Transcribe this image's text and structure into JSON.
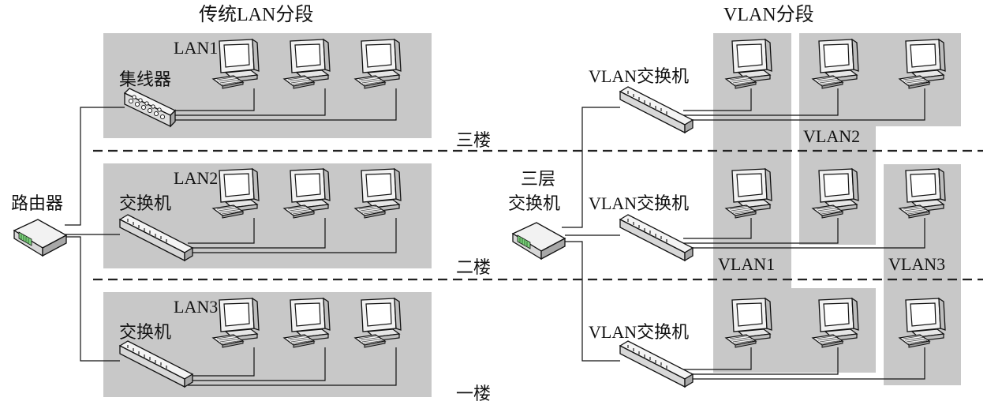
{
  "left": {
    "title": "传统LAN分段",
    "router_label": "路由器",
    "lans": [
      {
        "name": "LAN1",
        "device": "集线器"
      },
      {
        "name": "LAN2",
        "device": "交换机"
      },
      {
        "name": "LAN3",
        "device": "交换机"
      }
    ]
  },
  "right": {
    "title": "VLAN分段",
    "l3_switch_label_line1": "三层",
    "l3_switch_label_line2": "交换机",
    "vlan_switch_label": "VLAN交换机",
    "vlans": [
      "VLAN1",
      "VLAN2",
      "VLAN3"
    ]
  },
  "floors": [
    "三楼",
    "二楼",
    "一楼"
  ],
  "colors": {
    "zone": "#c8c8c8",
    "line": "#111111"
  }
}
